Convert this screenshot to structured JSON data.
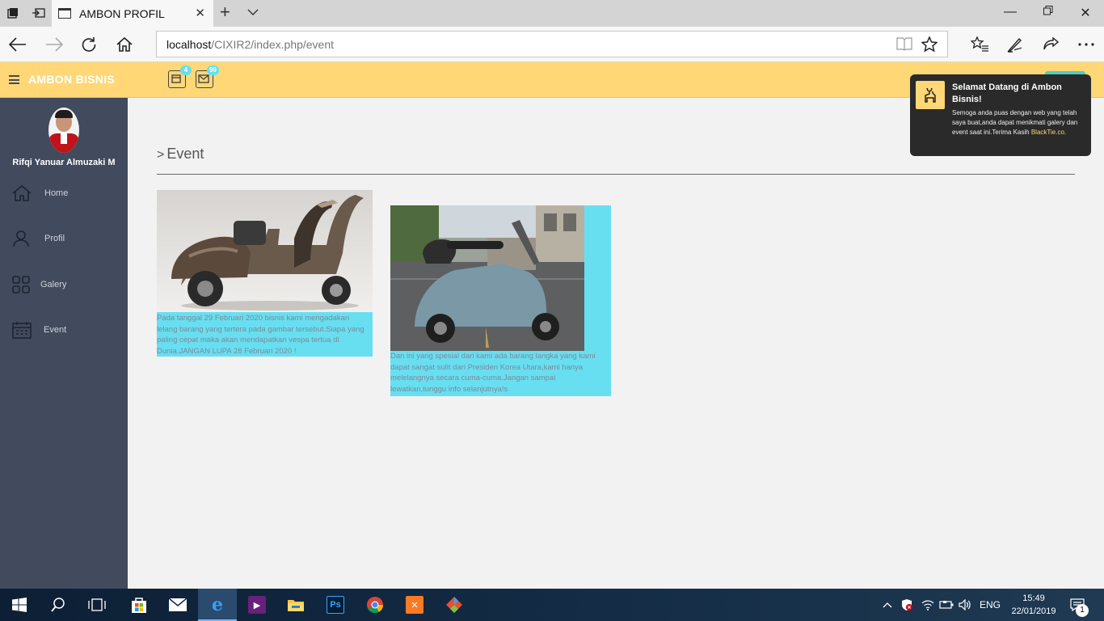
{
  "browser": {
    "tab_title": "AMBON PROFIL",
    "address_host": "localhost",
    "address_path": "/CIXIR2/index.php/event",
    "icons": [
      "tab-actions-icon",
      "set-aside-tabs-icon",
      "page-icon",
      "close-icon",
      "new-tab-icon",
      "tab-list-icon",
      "minimize-icon",
      "restore-icon",
      "close-window-icon",
      "back-icon",
      "forward-icon",
      "refresh-icon",
      "home-icon",
      "reading-view-icon",
      "favorite-star-icon",
      "favorites-hub-icon",
      "pen-icon",
      "share-icon",
      "more-icon"
    ]
  },
  "header": {
    "brand": "AMBON BISNIS",
    "tasks_count": "4",
    "messages_count": "99",
    "accent_color": "#ffd777"
  },
  "sidebar": {
    "username": "Rifqi Yanuar Almuzaki M",
    "items": [
      {
        "label": "Home",
        "icon": "home-icon"
      },
      {
        "label": "Profil",
        "icon": "user-icon"
      },
      {
        "label": "Galery",
        "icon": "gallery-icon"
      },
      {
        "label": "Event",
        "icon": "calendar-icon"
      }
    ]
  },
  "main": {
    "page_title": "Event",
    "events": [
      {
        "image": "rusty-vespa-photo",
        "description": "Pada tanggal 29 Februari 2020 bisnis kami mengadakan lelang barang yang tertera pada gambar tersebut.Siapa yang paling cepat maka akan mendapatkan vespa tertua di Dunia.JANGAN LUPA 28 Februari 2020 !"
      },
      {
        "image": "blue-vespa-street-photo",
        "description": "Dan ini yang spesial dari kami ada barang langka yang kami dapat sangat sulit dari Presiden Korea Utara,kami hanya melelangnya secara cuma-cuma.Jangan sampai lewatkan,tunggu info selanjutnya!s"
      }
    ],
    "card_color": "#68dff0"
  },
  "toast": {
    "title": "Selamat Datang di Ambon Bisnis!",
    "body": "Semoga anda puas dengan web yang telah saya buat,anda dapat menikmati galery dan event saat ini.Terima Kasih",
    "link": "BlackTie.co",
    "tail": "."
  },
  "taskbar": {
    "language": "ENG",
    "time": "15:49",
    "date": "22/01/2019",
    "notifications": "1",
    "apps": [
      "start-icon",
      "search-icon",
      "task-view-icon",
      "store-icon",
      "mail-icon",
      "edge-icon",
      "visual-studio-icon",
      "file-explorer-icon",
      "photoshop-icon",
      "chrome-icon",
      "xampp-icon",
      "git-icon"
    ]
  }
}
